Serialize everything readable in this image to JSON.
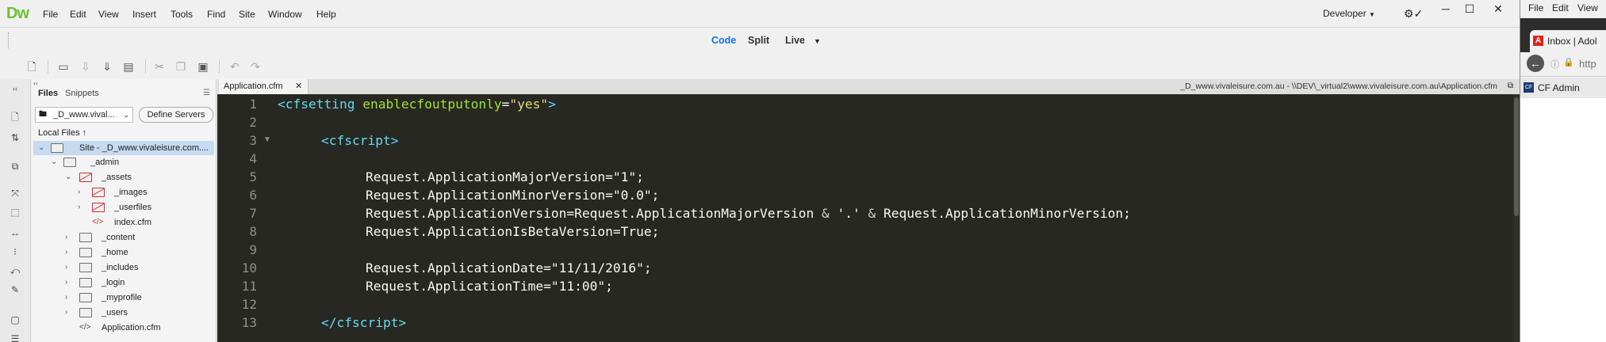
{
  "app": {
    "logo": "Dw",
    "menu": [
      "File",
      "Edit",
      "View",
      "Insert",
      "Tools",
      "Find",
      "Site",
      "Window",
      "Help"
    ],
    "workspace": "Developer",
    "window_controls": {
      "minimize": "─",
      "restore": "☐",
      "close": "✕"
    }
  },
  "view_switcher": {
    "code": "Code",
    "split": "Split",
    "live": "Live",
    "accent": "#1473e6"
  },
  "files_panel": {
    "tabs": [
      "Files",
      "Snippets"
    ],
    "site_select": "_D_www.vival...",
    "define_servers": "Define Servers",
    "local_files_label": "Local Files",
    "tree": [
      {
        "label": "Site - _D_www.vivaleisure.com....",
        "type": "site",
        "selected": true
      },
      {
        "label": "_admin",
        "type": "folder"
      },
      {
        "label": "_assets",
        "type": "folder-red"
      },
      {
        "label": "_images",
        "type": "folder-red"
      },
      {
        "label": "_userfiles",
        "type": "folder-red"
      },
      {
        "label": "index.cfm",
        "type": "file-red"
      },
      {
        "label": "_content",
        "type": "folder"
      },
      {
        "label": "_home",
        "type": "folder"
      },
      {
        "label": "_includes",
        "type": "folder"
      },
      {
        "label": "_login",
        "type": "folder"
      },
      {
        "label": "_myprofile",
        "type": "folder"
      },
      {
        "label": "_users",
        "type": "folder"
      },
      {
        "label": "Application.cfm",
        "type": "code"
      }
    ]
  },
  "document": {
    "tab_label": "Application.cfm",
    "path": "_D_www.vivaleisure.com.au - \\\\DEV\\_virtual2\\www.vivaleisure.com.au\\Application.cfm",
    "line_numbers": [
      "1",
      "2",
      "3",
      "4",
      "5",
      "6",
      "7",
      "8",
      "9",
      "10",
      "11",
      "12",
      "13"
    ],
    "code": {
      "l1_tag_open": "<cfsetting ",
      "l1_attr": "enablecfoutputonly",
      "l1_eq": "=",
      "l1_val": "\"yes\"",
      "l1_close": ">",
      "l3": "<cfscript>",
      "l5": "Request.ApplicationMajorVersion=\"1\";",
      "l6": "Request.ApplicationMinorVersion=\"0.0\";",
      "l7a": "Request.ApplicationVersion=Request.ApplicationMajorVersion ",
      "l7amp1": "&",
      "l7b": " '.' ",
      "l7amp2": "&",
      "l7c": " Request.ApplicationMinorVersion;",
      "l8": "Request.ApplicationIsBetaVersion=True;",
      "l10": "Request.ApplicationDate=\"11/11/2016\";",
      "l11": "Request.ApplicationTime=\"11:00\";",
      "l13": "</cfscript>"
    }
  },
  "browser": {
    "menu": [
      "File",
      "Edit",
      "View"
    ],
    "tab_title": "Inbox | Adol",
    "address": "http",
    "bookmark": "CF Admin"
  }
}
